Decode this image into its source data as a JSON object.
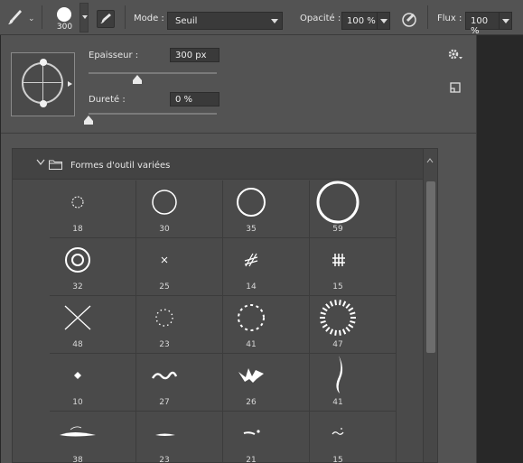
{
  "optionbar": {
    "tool": "brush-tool",
    "brush_size": "300",
    "mode_label": "Mode :",
    "mode_value": "Seuil",
    "opacity_label": "Opacité :",
    "opacity_value": "100 %",
    "flow_label": "Flux :",
    "flow_value": "100 %"
  },
  "brush_settings": {
    "size_label": "Epaisseur :",
    "size_value": "300 px",
    "size_slider": 0.38,
    "hardness_label": "Dureté :",
    "hardness_value": "0 %",
    "hardness_slider": 0
  },
  "brush_list": {
    "group_name": "Formes d'outil variées",
    "brushes": [
      {
        "size": "18",
        "shape": "dotted-circle-small"
      },
      {
        "size": "30",
        "shape": "ring-medium"
      },
      {
        "size": "35",
        "shape": "ring-large"
      },
      {
        "size": "59",
        "shape": "ring-thick"
      },
      {
        "size": "32",
        "shape": "double-ring"
      },
      {
        "size": "25",
        "shape": "small-cross"
      },
      {
        "size": "14",
        "shape": "hatch-marks"
      },
      {
        "size": "15",
        "shape": "grid-marks"
      },
      {
        "size": "48",
        "shape": "large-x"
      },
      {
        "size": "23",
        "shape": "dotted-ring"
      },
      {
        "size": "41",
        "shape": "dashed-ring"
      },
      {
        "size": "47",
        "shape": "radial-burst"
      },
      {
        "size": "10",
        "shape": "diamond"
      },
      {
        "size": "27",
        "shape": "squiggle"
      },
      {
        "size": "26",
        "shape": "splat"
      },
      {
        "size": "41",
        "shape": "calligraphy-stroke"
      },
      {
        "size": "38",
        "shape": "tapered-stroke"
      },
      {
        "size": "23",
        "shape": "thin-stroke"
      },
      {
        "size": "21",
        "shape": "dash-dot"
      },
      {
        "size": "15",
        "shape": "small-squiggle"
      }
    ]
  }
}
